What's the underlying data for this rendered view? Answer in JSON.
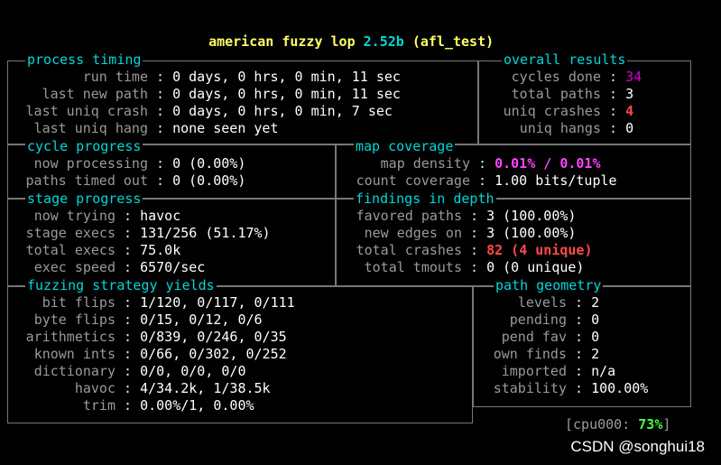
{
  "title": {
    "name": "american fuzzy lop",
    "version": "2.52b",
    "target": "(afl_test)"
  },
  "process_timing": {
    "header": "process timing",
    "rows": [
      {
        "label": "run time",
        "value": "0 days, 0 hrs, 0 min, 11 sec"
      },
      {
        "label": "last new path",
        "value": "0 days, 0 hrs, 0 min, 11 sec"
      },
      {
        "label": "last uniq crash",
        "value": "0 days, 0 hrs, 0 min, 7 sec"
      },
      {
        "label": "last uniq hang",
        "value": "none seen yet"
      }
    ]
  },
  "overall_results": {
    "header": "overall results",
    "rows": [
      {
        "label": "cycles done",
        "value": "34"
      },
      {
        "label": "total paths",
        "value": "3"
      },
      {
        "label": "uniq crashes",
        "value": "4"
      },
      {
        "label": "uniq hangs",
        "value": "0"
      }
    ]
  },
  "cycle_progress": {
    "header": "cycle progress",
    "rows": [
      {
        "label": "now processing",
        "value": "0 (0.00%)"
      },
      {
        "label": "paths timed out",
        "value": "0 (0.00%)"
      }
    ]
  },
  "map_coverage": {
    "header": "map coverage",
    "rows": [
      {
        "label": "map density",
        "value": "0.01% / 0.01%"
      },
      {
        "label": "count coverage",
        "value": "1.00 bits/tuple"
      }
    ]
  },
  "stage_progress": {
    "header": "stage progress",
    "rows": [
      {
        "label": "now trying",
        "value": "havoc"
      },
      {
        "label": "stage execs",
        "value": "131/256 (51.17%)"
      },
      {
        "label": "total execs",
        "value": "75.0k"
      },
      {
        "label": "exec speed",
        "value": "6570/sec"
      }
    ]
  },
  "findings": {
    "header": "findings in depth",
    "rows": [
      {
        "label": "favored paths",
        "value": "3 (100.00%)"
      },
      {
        "label": "new edges on",
        "value": "3 (100.00%)"
      },
      {
        "label": "total crashes",
        "value": "82 (4 unique)"
      },
      {
        "label": "total tmouts",
        "value": "0 (0 unique)"
      }
    ]
  },
  "strategy": {
    "header": "fuzzing strategy yields",
    "rows": [
      {
        "label": "bit flips",
        "value": "1/120, 0/117, 0/111"
      },
      {
        "label": "byte flips",
        "value": "0/15, 0/12, 0/6"
      },
      {
        "label": "arithmetics",
        "value": "0/839, 0/246, 0/35"
      },
      {
        "label": "known ints",
        "value": "0/66, 0/302, 0/252"
      },
      {
        "label": "dictionary",
        "value": "0/0, 0/0, 0/0"
      },
      {
        "label": "havoc",
        "value": "4/34.2k, 1/38.5k"
      },
      {
        "label": "trim",
        "value": "0.00%/1, 0.00%"
      }
    ]
  },
  "path_geometry": {
    "header": "path geometry",
    "rows": [
      {
        "label": "levels",
        "value": "2"
      },
      {
        "label": "pending",
        "value": "0"
      },
      {
        "label": "pend fav",
        "value": "0"
      },
      {
        "label": "own finds",
        "value": "2"
      },
      {
        "label": "imported",
        "value": "n/a"
      },
      {
        "label": "stability",
        "value": "100.00%"
      }
    ]
  },
  "cpu": {
    "label": "cpu000:",
    "value": "73%"
  },
  "watermark": "CSDN @songhui18"
}
